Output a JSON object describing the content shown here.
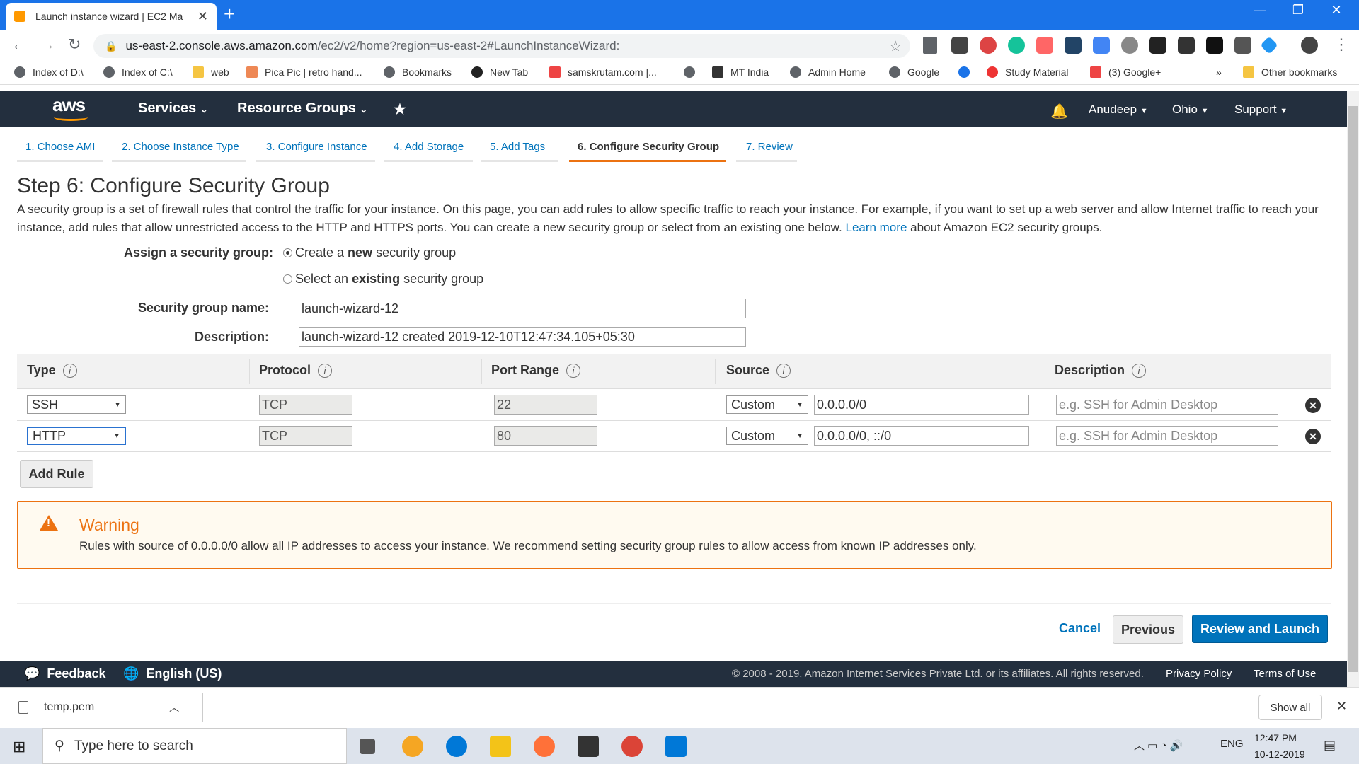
{
  "browser": {
    "tab_title": "Launch instance wizard | EC2 Ma",
    "url_host": "us-east-2.console.aws.amazon.com",
    "url_path": "/ec2/v2/home?region=us-east-2#LaunchInstanceWizard:",
    "bookmarks": [
      "Index of D:\\",
      "Index of C:\\",
      "web",
      "Pica Pic | retro hand...",
      "Bookmarks",
      "New Tab",
      "samskrutam.com |...",
      "MT India",
      "Admin Home",
      "Google",
      "Study Material",
      "(3) Google+"
    ],
    "other_bookmarks": "Other bookmarks",
    "more": "»"
  },
  "aws": {
    "logo": "aws",
    "services": "Services",
    "resource_groups": "Resource Groups",
    "user": "Anudeep",
    "region": "Ohio",
    "support": "Support"
  },
  "steps": [
    "1. Choose AMI",
    "2. Choose Instance Type",
    "3. Configure Instance",
    "4. Add Storage",
    "5. Add Tags",
    "6. Configure Security Group",
    "7. Review"
  ],
  "page": {
    "title": "Step 6: Configure Security Group",
    "intro_1": "A security group is a set of firewall rules that control the traffic for your instance. On this page, you can add rules to allow specific traffic to reach your instance. For example, if you want to set up a web server and allow Internet traffic to reach your instance, add rules that allow unrestricted access to the HTTP and HTTPS ports. You can create a new security group or select from an existing one below.",
    "learn_more": "Learn more",
    "intro_2": "about Amazon EC2 security groups.",
    "assign_label": "Assign a security group:",
    "radio_create_a": "Create a ",
    "radio_create_b": "new",
    "radio_create_c": " security group",
    "radio_select_a": "Select an ",
    "radio_select_b": "existing",
    "radio_select_c": " security group",
    "sg_name_label": "Security group name:",
    "sg_name_value": "launch-wizard-12",
    "desc_label": "Description:",
    "desc_value": "launch-wizard-12 created 2019-12-10T12:47:34.105+05:30"
  },
  "table": {
    "headers": [
      "Type",
      "Protocol",
      "Port Range",
      "Source",
      "Description"
    ],
    "info": "i",
    "rows": [
      {
        "type": "SSH",
        "protocol": "TCP",
        "port": "22",
        "source_mode": "Custom",
        "source": "0.0.0.0/0",
        "desc_placeholder": "e.g. SSH for Admin Desktop"
      },
      {
        "type": "HTTP",
        "protocol": "TCP",
        "port": "80",
        "source_mode": "Custom",
        "source": "0.0.0.0/0, ::/0",
        "desc_placeholder": "e.g. SSH for Admin Desktop"
      }
    ],
    "add_rule": "Add Rule"
  },
  "warning": {
    "title": "Warning",
    "text": "Rules with source of 0.0.0.0/0 allow all IP addresses to access your instance. We recommend setting security group rules to allow access from known IP addresses only."
  },
  "actions": {
    "cancel": "Cancel",
    "previous": "Previous",
    "launch": "Review and Launch"
  },
  "footer": {
    "feedback": "Feedback",
    "language": "English (US)",
    "copyright": "© 2008 - 2019, Amazon Internet Services Private Ltd. or its affiliates. All rights reserved.",
    "privacy": "Privacy Policy",
    "terms": "Terms of Use"
  },
  "download": {
    "file": "temp.pem",
    "show_all": "Show all"
  },
  "taskbar": {
    "search": "Type here to search",
    "lang": "ENG",
    "time": "12:47 PM",
    "date": "10-12-2019"
  }
}
